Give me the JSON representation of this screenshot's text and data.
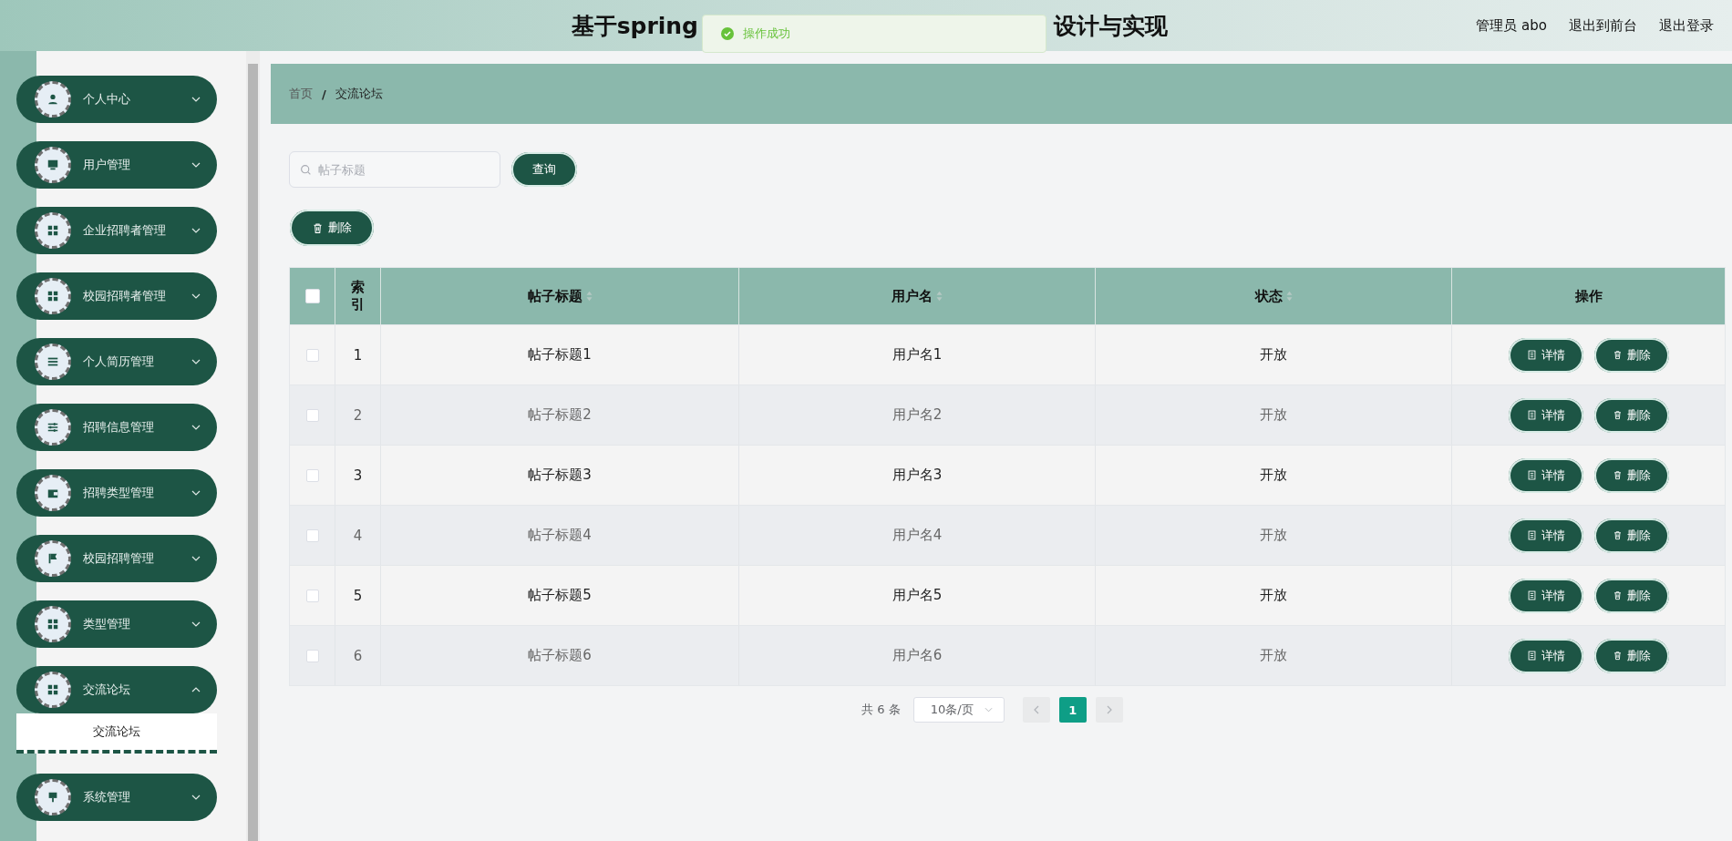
{
  "header": {
    "title_start": "基于spring",
    "title_end": "设计与实现",
    "user": "管理员 abo",
    "links": [
      "退出到前台",
      "退出登录"
    ]
  },
  "toast": {
    "message": "操作成功"
  },
  "sidebar": {
    "items": [
      {
        "label": "个人中心",
        "expanded": false
      },
      {
        "label": "用户管理",
        "expanded": false
      },
      {
        "label": "企业招聘者管理",
        "expanded": false
      },
      {
        "label": "校园招聘者管理",
        "expanded": false
      },
      {
        "label": "个人简历管理",
        "expanded": false
      },
      {
        "label": "招聘信息管理",
        "expanded": false
      },
      {
        "label": "招聘类型管理",
        "expanded": false
      },
      {
        "label": "校园招聘管理",
        "expanded": false
      },
      {
        "label": "类型管理",
        "expanded": false
      },
      {
        "label": "交流论坛",
        "expanded": true,
        "children": [
          {
            "label": "交流论坛",
            "selected": true
          }
        ]
      },
      {
        "label": "系统管理",
        "expanded": false
      }
    ]
  },
  "breadcrumb": {
    "separator": "/",
    "items": [
      "首页",
      "交流论坛"
    ]
  },
  "search": {
    "placeholder": "帖子标题",
    "button": "查询"
  },
  "toolbar": {
    "delete": "删除"
  },
  "table": {
    "header_checked": false,
    "columns": [
      {
        "label": "索引",
        "sortable": false
      },
      {
        "label": "帖子标题",
        "sortable": true
      },
      {
        "label": "用户名",
        "sortable": true
      },
      {
        "label": "状态",
        "sortable": true
      },
      {
        "label": "操作",
        "sortable": false
      }
    ],
    "rows": [
      {
        "checked": false,
        "index": "1",
        "title": "帖子标题1",
        "user": "用户名1",
        "status": "开放",
        "actions": [
          "详情",
          "删除"
        ]
      },
      {
        "checked": false,
        "index": "2",
        "title": "帖子标题2",
        "user": "用户名2",
        "status": "开放",
        "actions": [
          "详情",
          "删除"
        ]
      },
      {
        "checked": false,
        "index": "3",
        "title": "帖子标题3",
        "user": "用户名3",
        "status": "开放",
        "actions": [
          "详情",
          "删除"
        ]
      },
      {
        "checked": false,
        "index": "4",
        "title": "帖子标题4",
        "user": "用户名4",
        "status": "开放",
        "actions": [
          "详情",
          "删除"
        ]
      },
      {
        "checked": false,
        "index": "5",
        "title": "帖子标题5",
        "user": "用户名5",
        "status": "开放",
        "actions": [
          "详情",
          "删除"
        ]
      },
      {
        "checked": false,
        "index": "6",
        "title": "帖子标题6",
        "user": "用户名6",
        "status": "开放",
        "actions": [
          "详情",
          "删除"
        ]
      }
    ]
  },
  "pagination": {
    "total": "共 6 条",
    "page_size": "10条/页",
    "pages": [
      {
        "label": "1",
        "selected": true
      }
    ]
  }
}
